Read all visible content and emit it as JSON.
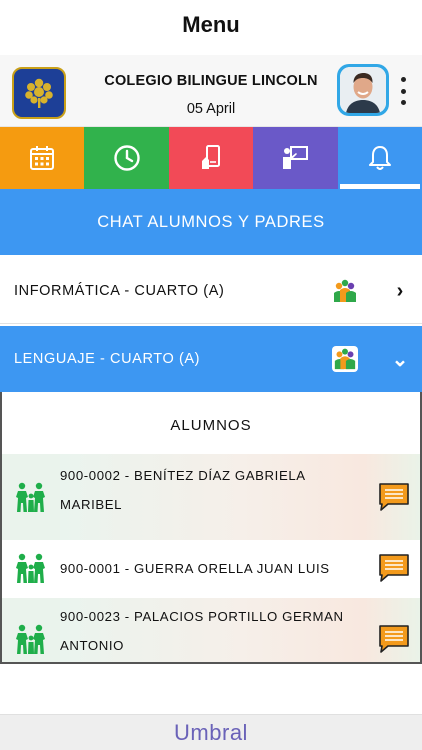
{
  "title": "Menu",
  "header": {
    "school_name": "COLEGIO BILINGUE LINCOLN",
    "date": "05 April"
  },
  "tabs": [
    {
      "id": "calendar",
      "icon": "calendar-icon",
      "color": "#f59b10"
    },
    {
      "id": "clock",
      "icon": "clock-icon",
      "color": "#31b24c"
    },
    {
      "id": "tasks",
      "icon": "hand-tablet-icon",
      "color": "#f24a57"
    },
    {
      "id": "teacher",
      "icon": "teacher-board-icon",
      "color": "#6a59c8"
    },
    {
      "id": "notifications",
      "icon": "bell-icon",
      "color": "#3d97f2",
      "active": true
    }
  ],
  "chat_banner": "CHAT ALUMNOS Y PADRES",
  "courses": [
    {
      "label": "INFORMÁTICA - CUARTO (A)",
      "state": "collapsed",
      "chevron": "›"
    },
    {
      "label": "LENGUAJE - CUARTO (A)",
      "state": "expanded",
      "chevron": "⌄"
    }
  ],
  "panel": {
    "title": "ALUMNOS",
    "students": [
      {
        "line1": "900-0002 - BENÍTEZ DÍAZ GABRIELA",
        "line2": "MARIBEL"
      },
      {
        "line1": "900-0001 - GUERRA ORELLA JUAN LUIS",
        "line2": ""
      },
      {
        "line1": "900-0023 - PALACIOS PORTILLO GERMAN",
        "line2": "ANTONIO"
      }
    ]
  },
  "footer": {
    "brand": "Umbral"
  },
  "colors": {
    "accent": "#3d97f2",
    "brand": "#6a62b8",
    "family_icon": "#1fae4a",
    "message_icon": "#f39a1c"
  }
}
